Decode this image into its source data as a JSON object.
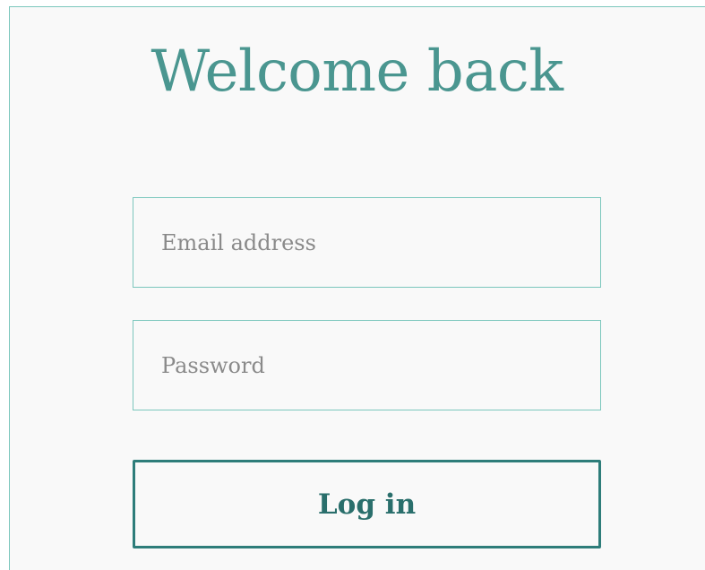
{
  "login_form": {
    "title": "Welcome back",
    "email_placeholder": "Email address",
    "email_value": "",
    "password_placeholder": "Password",
    "password_value": "",
    "submit_label": "Log in"
  },
  "colors": {
    "accent": "#4a9690",
    "button_border": "#2e7d7a",
    "field_border": "#7cc7bd",
    "background": "#f9f9f9",
    "placeholder": "#8a8a8a"
  }
}
